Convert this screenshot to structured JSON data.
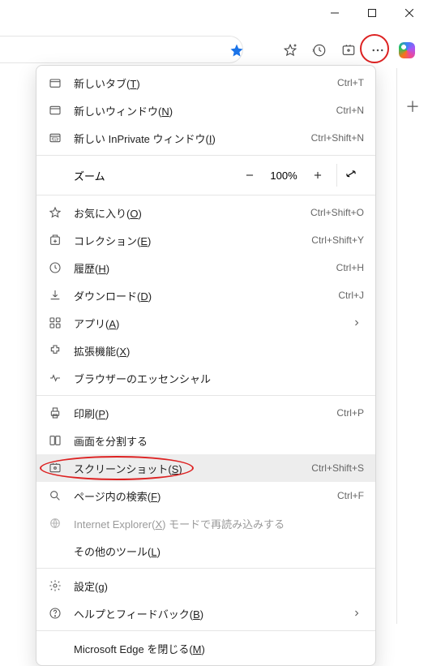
{
  "window": {
    "minimize": "min",
    "maximize": "max",
    "close": "close"
  },
  "zoom": {
    "label": "ズーム",
    "value": "100%"
  },
  "menu": {
    "new_tab": {
      "label": "新しいタブ",
      "key": "T",
      "shortcut": "Ctrl+T"
    },
    "new_window": {
      "label": "新しいウィンドウ",
      "key": "N",
      "shortcut": "Ctrl+N"
    },
    "new_inprivate": {
      "label": "新しい InPrivate ウィンドウ",
      "key": "I",
      "shortcut": "Ctrl+Shift+N"
    },
    "favorites": {
      "label": "お気に入り",
      "key": "O",
      "shortcut": "Ctrl+Shift+O"
    },
    "collections": {
      "label": "コレクション",
      "key": "E",
      "shortcut": "Ctrl+Shift+Y"
    },
    "history": {
      "label": "履歴",
      "key": "H",
      "shortcut": "Ctrl+H"
    },
    "downloads": {
      "label": "ダウンロード",
      "key": "D",
      "shortcut": "Ctrl+J"
    },
    "apps": {
      "label": "アプリ",
      "key": "A",
      "shortcut": ""
    },
    "extensions": {
      "label": "拡張機能",
      "key": "X",
      "shortcut": ""
    },
    "essentials": {
      "label": "ブラウザーのエッセンシャル",
      "key": "",
      "shortcut": ""
    },
    "print": {
      "label": "印刷",
      "key": "P",
      "shortcut": "Ctrl+P"
    },
    "split": {
      "label": "画面を分割する",
      "key": "",
      "shortcut": ""
    },
    "screenshot": {
      "label": "スクリーンショット",
      "key": "S",
      "shortcut": "Ctrl+Shift+S"
    },
    "find": {
      "label": "ページ内の検索",
      "key": "F",
      "shortcut": "Ctrl+F"
    },
    "ie_mode": {
      "label": "Internet Explorer",
      "key": "X",
      "suffix": " モードで再読み込みする",
      "shortcut": ""
    },
    "more_tools": {
      "label": "その他のツール",
      "key": "L",
      "shortcut": ""
    },
    "settings": {
      "label": "設定",
      "key": "g",
      "shortcut": ""
    },
    "help": {
      "label": "ヘルプとフィードバック",
      "key": "B",
      "shortcut": ""
    },
    "close_edge": {
      "label": "Microsoft Edge を閉じる",
      "key": "M",
      "shortcut": ""
    }
  }
}
